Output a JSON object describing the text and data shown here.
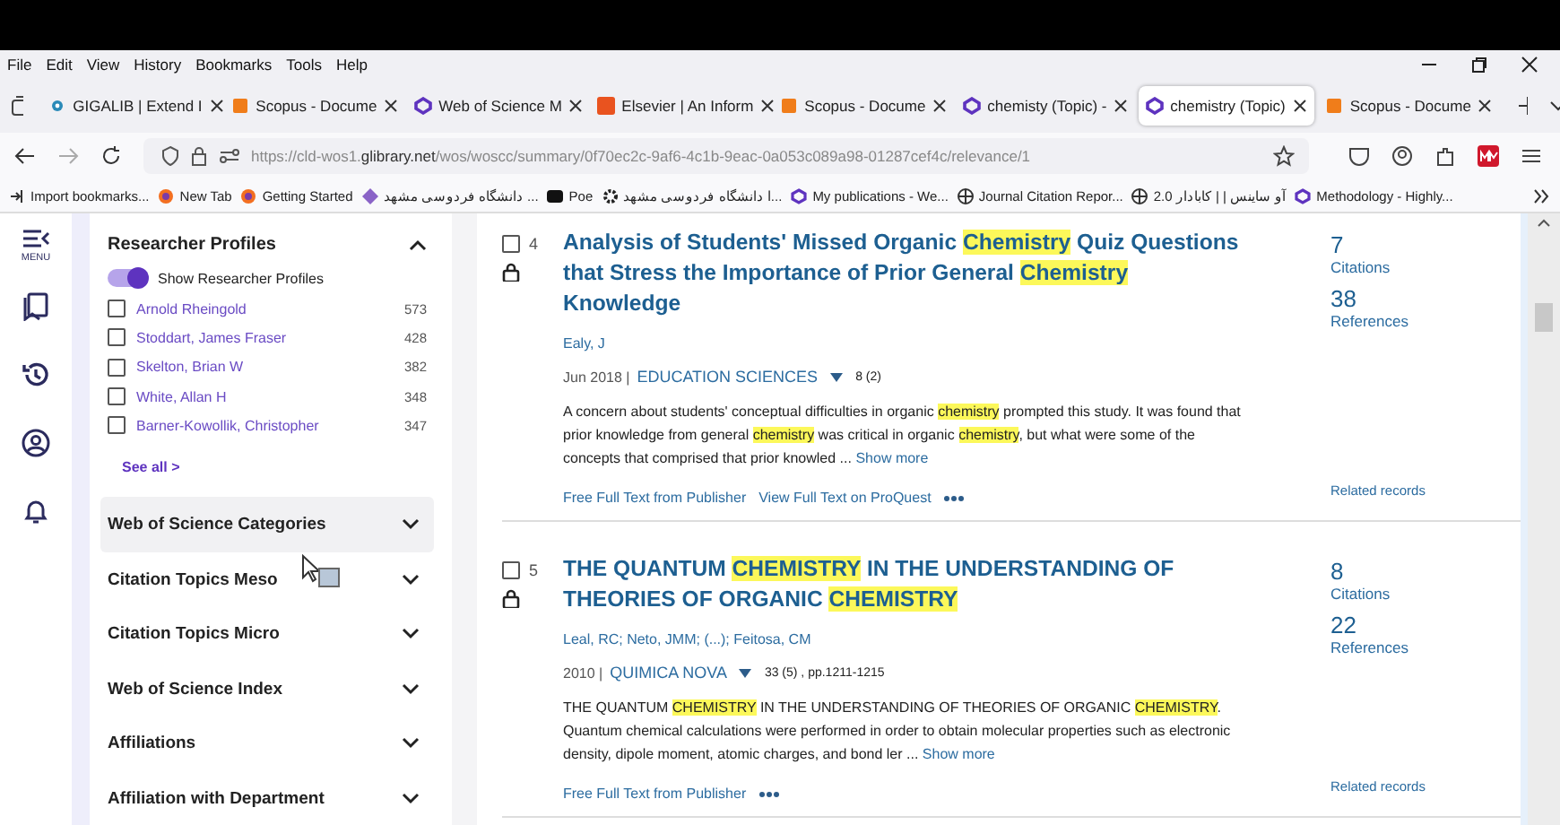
{
  "window": {
    "menu": [
      "File",
      "Edit",
      "View",
      "History",
      "Bookmarks",
      "Tools",
      "Help"
    ]
  },
  "tabs": [
    {
      "label": "GIGALIB | Extend I",
      "kind": "gigalib",
      "selected": false
    },
    {
      "label": "Scopus - Docume",
      "kind": "scopus",
      "selected": false
    },
    {
      "label": "Web of Science M",
      "kind": "wos",
      "selected": false
    },
    {
      "label": "Elsevier | An Inform",
      "kind": "elsevier",
      "selected": false
    },
    {
      "label": "Scopus - Docume",
      "kind": "scopus",
      "selected": false
    },
    {
      "label": "chemisty (Topic) -",
      "kind": "wos",
      "selected": false
    },
    {
      "label": "chemistry (Topic)",
      "kind": "wos",
      "selected": true
    },
    {
      "label": "Scopus - Docume",
      "kind": "scopus",
      "selected": false
    }
  ],
  "address_bar": {
    "url_host": "https://cld-wos1.",
    "url_domain": "glibrary.net",
    "url_path": "/wos/woscc/summary/0f70ec2c-9af6-4c1b-9eac-0a053c089a98-01287cef4c/relevance/1"
  },
  "bookmarks": [
    {
      "label": "Import bookmarks...",
      "kind": "import"
    },
    {
      "label": "New Tab",
      "kind": "firefox"
    },
    {
      "label": "Getting Started",
      "kind": "firefox"
    },
    {
      "label": "دانشگاه فردوسی مشهد ...",
      "kind": "star"
    },
    {
      "label": "Poe",
      "kind": "poe"
    },
    {
      "label": "ا دانشگاه فردوسی مشهد...",
      "kind": "gear"
    },
    {
      "label": "My publications - We...",
      "kind": "wos"
    },
    {
      "label": "Journal Citation Repor...",
      "kind": "globe"
    },
    {
      "label": "آو ساینس | | کابادار 2.0",
      "kind": "globe"
    },
    {
      "label": "Methodology - Highly...",
      "kind": "wos"
    }
  ],
  "rail": {
    "menu_label": "MENU"
  },
  "researcher_profiles": {
    "title": "Researcher Profiles",
    "expanded": true,
    "toggle": {
      "label": "Show Researcher Profiles",
      "on": true
    },
    "items": [
      {
        "name": "Arnold Rheingold",
        "count": "573",
        "checked": false
      },
      {
        "name": "Stoddart, James Fraser",
        "count": "428",
        "checked": false
      },
      {
        "name": "Skelton, Brian W",
        "count": "382",
        "checked": false
      },
      {
        "name": "White, Allan H",
        "count": "348",
        "checked": false
      },
      {
        "name": "Barner-Kowollik, Christopher",
        "count": "347",
        "checked": false
      }
    ],
    "see_all": "See all >"
  },
  "facets": [
    {
      "label": "Web of Science Categories",
      "expanded": false,
      "hovered": true
    },
    {
      "label": "Citation Topics Meso",
      "expanded": false,
      "hovered": false
    },
    {
      "label": "Citation Topics Micro",
      "expanded": false,
      "hovered": false
    },
    {
      "label": "Web of Science Index",
      "expanded": false,
      "hovered": false
    },
    {
      "label": "Affiliations",
      "expanded": false,
      "hovered": false
    },
    {
      "label": "Affiliation with Department",
      "expanded": false,
      "hovered": false
    }
  ],
  "records": [
    {
      "number": "4",
      "checked": false,
      "title": [
        {
          "text": "Analysis of Students' Missed Organic ",
          "highlight": false
        },
        {
          "text": "Chemistry",
          "highlight": true
        },
        {
          "text": " Quiz Questions that Stress the Importance of Prior General ",
          "highlight": false
        },
        {
          "text": "Chemistry",
          "highlight": true
        },
        {
          "text": " Knowledge",
          "highlight": false
        }
      ],
      "authors": "Ealy, J",
      "date": "Jun 2018 |",
      "journal": "EDUCATION SCIENCES",
      "details": "8 (2)",
      "abstract": [
        {
          "text": "A concern about students' conceptual difficulties in organic ",
          "highlight": false
        },
        {
          "text": "chemistry",
          "highlight": true
        },
        {
          "text": " prompted this study. It was found that prior knowledge from general ",
          "highlight": false
        },
        {
          "text": "chemistry",
          "highlight": true
        },
        {
          "text": " was critical in organic ",
          "highlight": false
        },
        {
          "text": "chemistry",
          "highlight": true
        },
        {
          "text": ", but what were some of the concepts that comprised that prior knowled ...",
          "highlight": false
        }
      ],
      "show_more": "Show more",
      "links": [
        "Free Full Text from Publisher",
        "View Full Text on ProQuest"
      ],
      "citations": "7",
      "citations_label": "Citations",
      "references": "38",
      "references_label": "References",
      "related": "Related records"
    },
    {
      "number": "5",
      "checked": false,
      "title": [
        {
          "text": "THE QUANTUM ",
          "highlight": false
        },
        {
          "text": "CHEMISTRY",
          "highlight": true
        },
        {
          "text": " IN THE UNDERSTANDING OF THEORIES OF ORGANIC ",
          "highlight": false
        },
        {
          "text": "CHEMISTRY",
          "highlight": true
        }
      ],
      "authors": "Leal, RC; Neto, JMM; (...); Feitosa, CM",
      "date": "2010 |",
      "journal": "QUIMICA NOVA",
      "details": "33 (5) , pp.1211-1215",
      "abstract": [
        {
          "text": "THE QUANTUM ",
          "highlight": false
        },
        {
          "text": "CHEMISTRY",
          "highlight": true
        },
        {
          "text": " IN THE UNDERSTANDING OF THEORIES OF ORGANIC ",
          "highlight": false
        },
        {
          "text": "CHEMISTRY",
          "highlight": true
        },
        {
          "text": ". Quantum chemical calculations were performed in order to obtain molecular properties such as electronic density, dipole moment, atomic charges, and bond ler ...",
          "highlight": false
        }
      ],
      "show_more": "Show more",
      "links": [
        "Free Full Text from Publisher"
      ],
      "citations": "8",
      "citations_label": "Citations",
      "references": "22",
      "references_label": "References",
      "related": "Related records"
    }
  ]
}
